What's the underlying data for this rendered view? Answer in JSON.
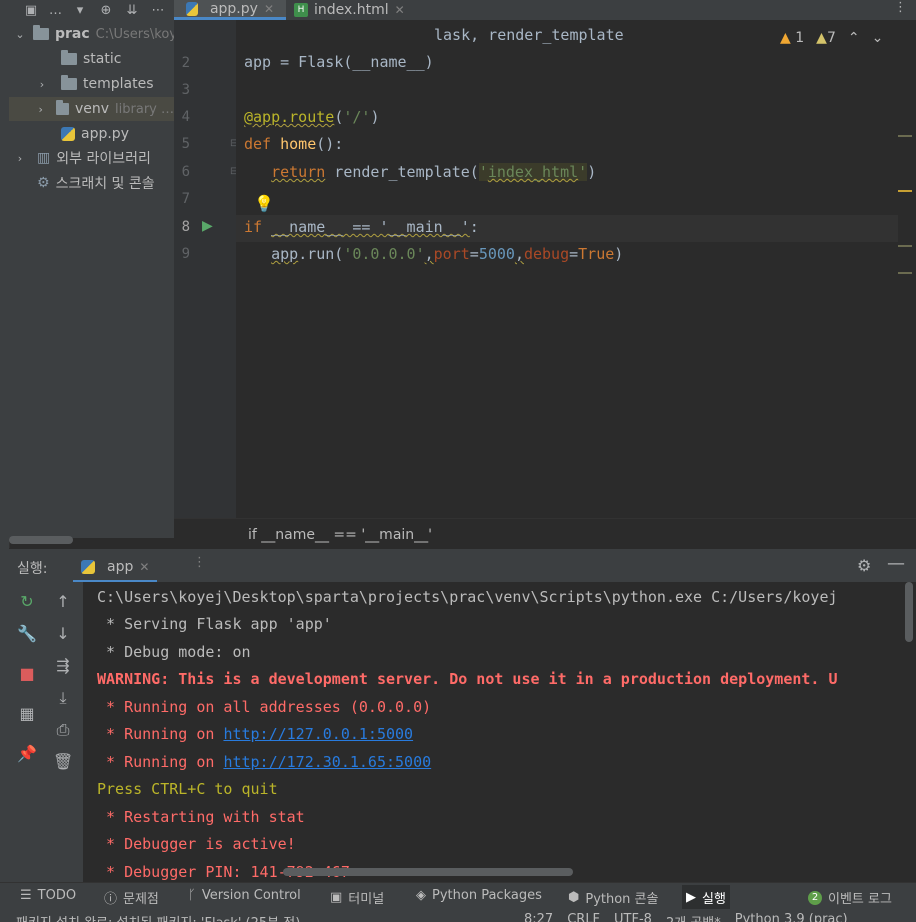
{
  "project_toolbar": {
    "menu_label": "…"
  },
  "project_tree": {
    "root": {
      "name": "prac",
      "path": "C:\\Users\\koyej\\Desktop\\sparta\\projects\\prac"
    },
    "items": [
      {
        "name": "static",
        "extra": ""
      },
      {
        "name": "templates",
        "extra": ""
      },
      {
        "name": "venv",
        "extra": "library …"
      },
      {
        "name": "app.py",
        "extra": ""
      },
      {
        "name": "외부 라이브러리",
        "extra": ""
      },
      {
        "name": "스크래치 및 콘솔",
        "extra": ""
      }
    ]
  },
  "editor_tabs": [
    {
      "label": "app.py",
      "active": true
    },
    {
      "label": "index.html",
      "active": false
    }
  ],
  "inspections": {
    "warnings": "1",
    "weak_warnings": "7"
  },
  "code": {
    "line1_tail": "lask, render_template",
    "line_numbers": [
      "2",
      "3",
      "4",
      "5",
      "6",
      "7",
      "8",
      "9"
    ],
    "current_line": "8"
  },
  "breadcrumb": "if __name__ == '__main__'",
  "run": {
    "label": "실행:",
    "tab": "app",
    "console": [
      "C:\\Users\\koyej\\Desktop\\sparta\\projects\\prac\\venv\\Scripts\\python.exe C:/Users/koyej",
      " * Serving Flask app 'app'",
      " * Debug mode: on",
      "WARNING: This is a development server. Do not use it in a production deployment. U",
      " * Running on all addresses (0.0.0.0)",
      " * Running on ",
      "http://127.0.0.1:5000",
      " * Running on ",
      "http://172.30.1.65:5000",
      "Press CTRL+C to quit",
      " * Restarting with stat",
      " * Debugger is active!",
      " * Debugger PIN: 141-792-467"
    ]
  },
  "tool_strip": {
    "todo": "TODO",
    "problems": "문제점",
    "vcs": "Version Control",
    "terminal": "터미널",
    "packages": "Python Packages",
    "python_console": "Python 콘솔",
    "run": "실행",
    "event_log": "이벤트 로그",
    "event_count": "2"
  },
  "status_bar": {
    "message": "패키지 설치 완료: 설치된 패키지: 'Flask' (25분 전)",
    "position": "8:27",
    "line_sep": "CRLF",
    "encoding": "UTF-8",
    "indent": "2개 공백*",
    "interpreter": "Python 3.9 (prac)"
  },
  "colors": {
    "accent": "#4a88c7",
    "run_green": "#59a869",
    "error_red": "#ff6b68"
  }
}
